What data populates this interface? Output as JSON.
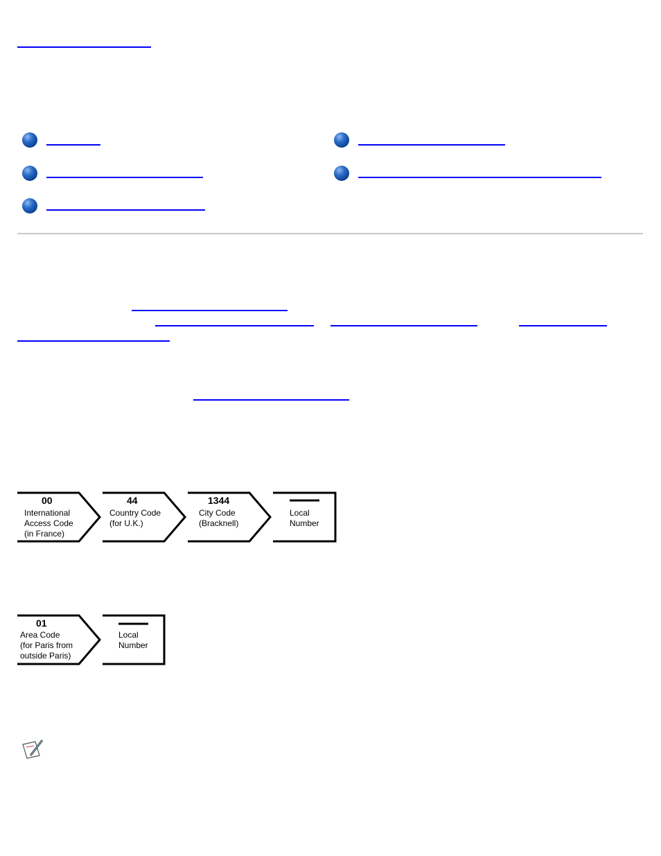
{
  "diagram1": {
    "boxes": [
      {
        "code": "00",
        "label": "International\nAccess Code\n(in France)"
      },
      {
        "code": "44",
        "label": "Country Code\n(for U.K.)"
      },
      {
        "code": "1344",
        "label": "City Code\n(Bracknell)"
      },
      {
        "code": "",
        "label": "Local\nNumber"
      }
    ]
  },
  "diagram2": {
    "boxes": [
      {
        "code": "01",
        "label": "Area Code\n(for Paris from\noutside Paris)"
      },
      {
        "code": "",
        "label": "Local\nNumber"
      }
    ]
  },
  "colors": {
    "link": "#0000ff",
    "divider": "#c8c8c8"
  },
  "icons": {
    "bullet": "blue-globe-bullet",
    "note": "note-pencil-icon"
  }
}
